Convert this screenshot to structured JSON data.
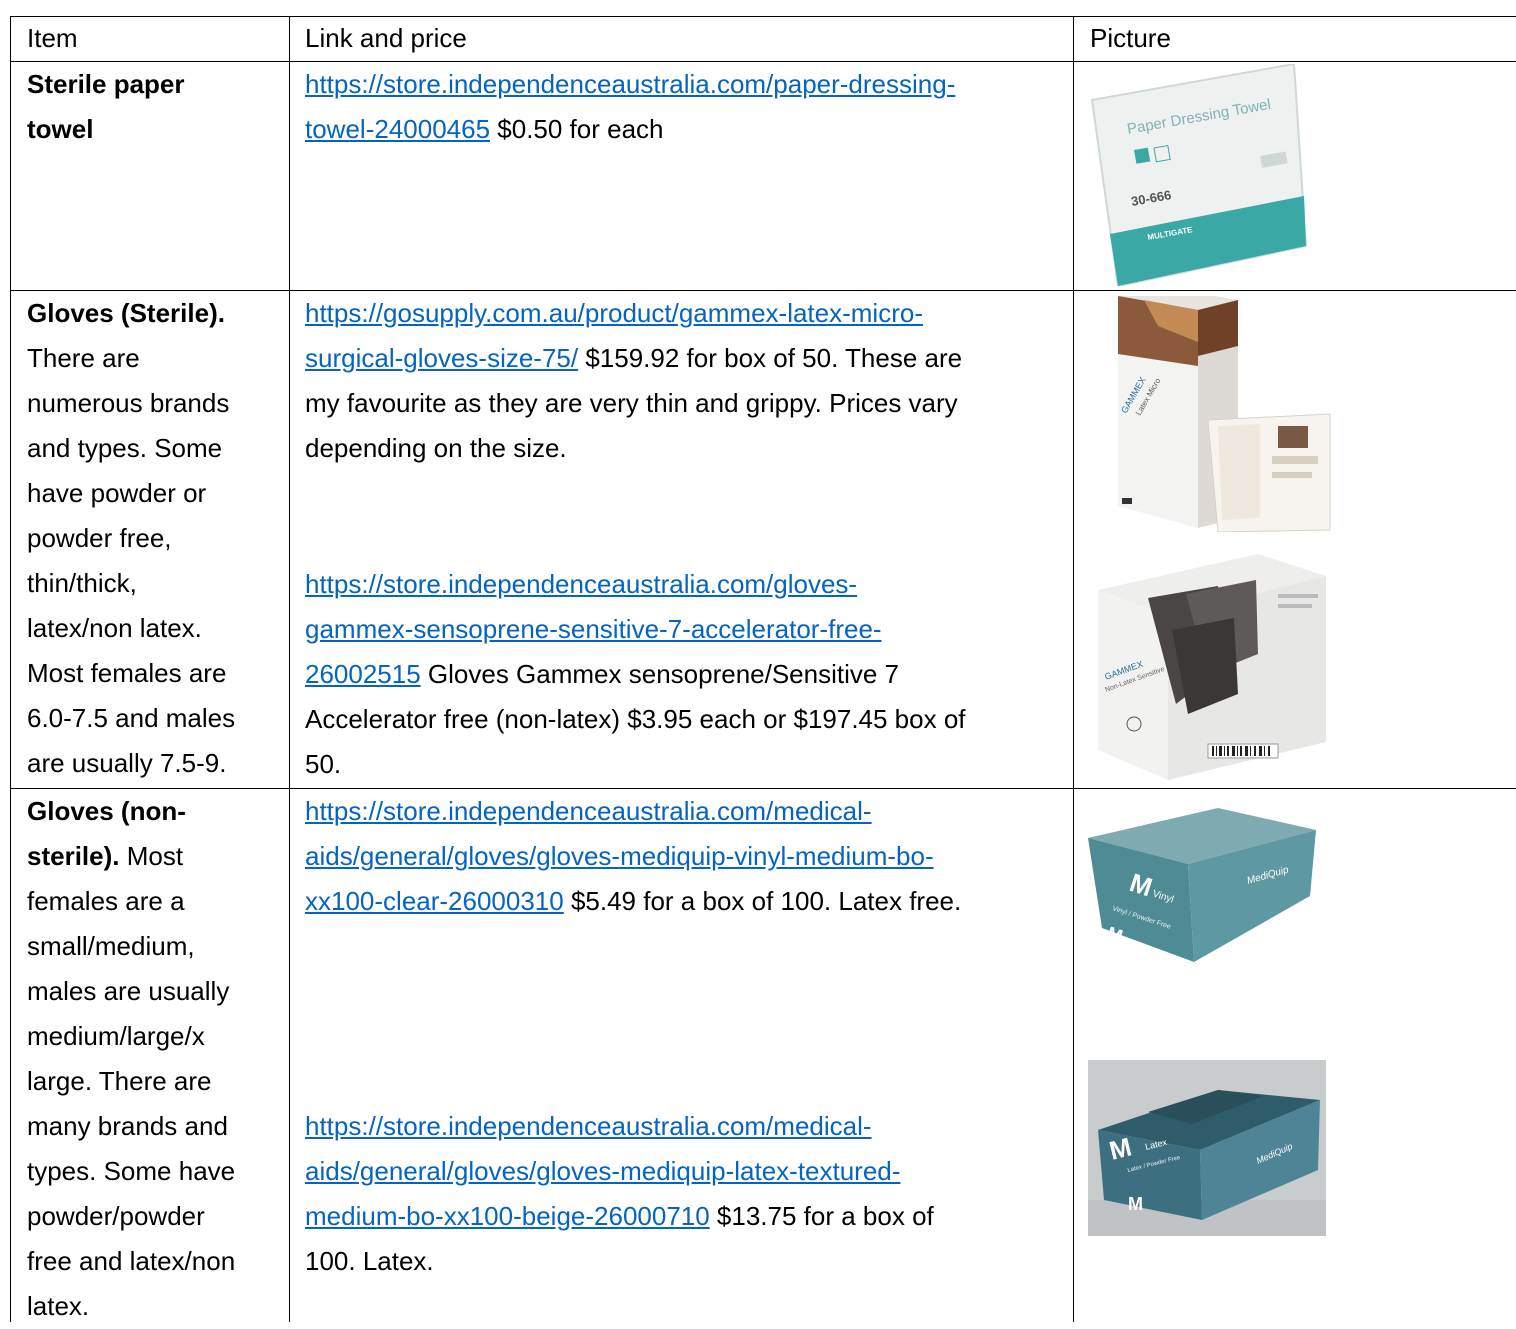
{
  "header": {
    "item": "Item",
    "link": "Link and price",
    "picture": "Picture"
  },
  "rows": [
    {
      "item_title": "Sterile paper towel",
      "item_rest": "",
      "entries": [
        {
          "url_lines": [
            "https://store.independenceaustralia.com/paper-dressing-",
            "towel-24000465"
          ],
          "after_link": " $0.50 for each",
          "text_lines": []
        }
      ]
    },
    {
      "item_title": "Gloves (Sterile).",
      "item_rest": "There are numerous brands and types. Some have powder or powder free, thin/thick, latex/non latex. Most females are 6.0-7.5 and males are usually 7.5-9.",
      "entries": [
        {
          "url_lines": [
            "https://gosupply.com.au/product/gammex-latex-micro-",
            "surgical-gloves-size-75/"
          ],
          "after_link": " $159.92 for box of 50. These are",
          "text_lines": [
            "my favourite as they are very thin and grippy. Prices vary",
            "depending on the size."
          ]
        },
        {
          "url_lines": [
            "https://store.independenceaustralia.com/gloves-",
            "gammex-sensoprene-sensitive-7-accelerator-free-",
            "26002515"
          ],
          "after_link": " Gloves Gammex sensoprene/Sensitive 7",
          "text_lines": [
            "Accelerator free (non-latex) $3.95 each or $197.45 box of",
            "50."
          ]
        }
      ]
    },
    {
      "item_title": "Gloves (non-sterile).",
      "item_rest": "Most females are a small/medium, males are usually medium/large/x large. There are many brands and types. Some have powder/powder free and latex/non latex.",
      "entries": [
        {
          "url_lines": [
            "https://store.independenceaustralia.com/medical-",
            "aids/general/gloves/gloves-mediquip-vinyl-medium-bo-",
            "xx100-clear-26000310"
          ],
          "after_link": "  $5.49 for a box of 100. Latex free.",
          "text_lines": []
        },
        {
          "url_lines": [
            "https://store.independenceaustralia.com/medical-",
            "aids/general/gloves/gloves-mediquip-latex-textured-",
            "medium-bo-xx100-beige-26000710"
          ],
          "after_link": "  $13.75 for a box of",
          "text_lines": [
            "100. Latex."
          ]
        }
      ]
    }
  ],
  "item_lines": {
    "row1": [
      [
        "Sterile paper",
        true
      ],
      [
        "towel",
        true
      ]
    ],
    "row2": [
      [
        "Gloves (Sterile).",
        true
      ],
      [
        "There are",
        false
      ],
      [
        "numerous brands",
        false
      ],
      [
        "and types. Some",
        false
      ],
      [
        "have powder or",
        false
      ],
      [
        "powder free,",
        false
      ],
      [
        "thin/thick,",
        false
      ],
      [
        "latex/non latex.",
        false
      ],
      [
        "Most females are",
        false
      ],
      [
        "6.0-7.5 and males",
        false
      ],
      [
        "are usually 7.5-9.",
        false
      ]
    ],
    "row3": [
      [
        "Gloves (non-",
        true
      ],
      [
        "sterile).",
        true,
        " Most"
      ],
      [
        "females are a",
        false
      ],
      [
        "small/medium,",
        false
      ],
      [
        "males are usually",
        false
      ],
      [
        "medium/large/x",
        false
      ],
      [
        "large. There are",
        false
      ],
      [
        "many brands and",
        false
      ],
      [
        "types. Some have",
        false
      ],
      [
        "powder/powder",
        false
      ],
      [
        "free and latex/non",
        false
      ],
      [
        "latex.",
        false
      ]
    ]
  },
  "pictures": {
    "paper_towel": {
      "brand_text": "Paper Dressing Towel",
      "code": "30-666",
      "maker": "MULTIGATE"
    },
    "gammex_micro": {
      "brand_text": "GAMMEX",
      "sub": "Latex Micro"
    },
    "gammex_sensoprene": {
      "brand_text": "GAMMEX",
      "sub": "Non-Latex Sensitive"
    },
    "vinyl_box": {
      "size": "M",
      "type": "Vinyl",
      "desc": "Vinyl / Powder Free",
      "brand": "MediQuip"
    },
    "latex_box": {
      "size": "M",
      "type": "Latex",
      "desc": "Latex / Powder Free",
      "brand": "MediQuip"
    }
  },
  "colors": {
    "link": "#0563c1",
    "teal_box": "#4f8b95",
    "teal_light": "#7fb7bf",
    "towel_teal": "#2aa7a3"
  }
}
